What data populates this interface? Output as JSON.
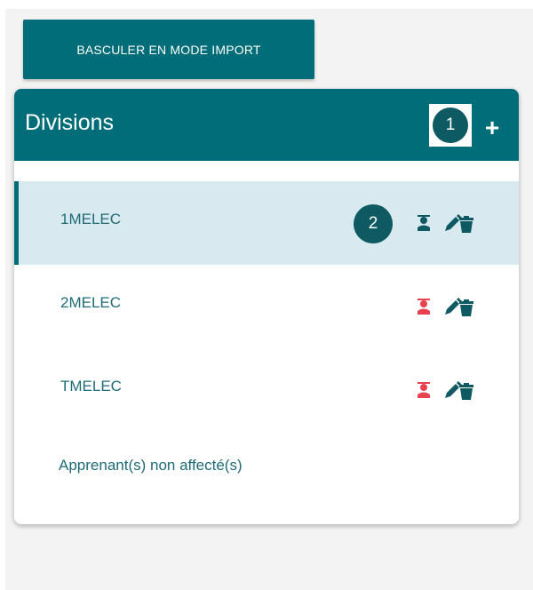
{
  "toolbar": {
    "import_mode_label": "BASCULER EN MODE IMPORT"
  },
  "panel": {
    "title": "Divisions",
    "step_badge": "1",
    "add_label": "+",
    "rows": [
      {
        "label": "1MELEC",
        "selected": true,
        "step_badge": "2",
        "user_icon_color": "#0d5a63"
      },
      {
        "label": "2MELEC",
        "selected": false,
        "user_icon_color": "#e8424f"
      },
      {
        "label": "TMELEC",
        "selected": false,
        "user_icon_color": "#e8424f"
      }
    ],
    "unassigned_label": "Apprenant(s) non affecté(s)"
  },
  "icons": {
    "user": "user-icon",
    "edit_delete": "pencil-trash-icon",
    "add": "plus-icon"
  },
  "colors": {
    "brand": "#006d78",
    "badge": "#0d5a63",
    "selected_row": "#d8e9ef",
    "text": "#1f6b76",
    "alert_icon": "#e8424f"
  }
}
